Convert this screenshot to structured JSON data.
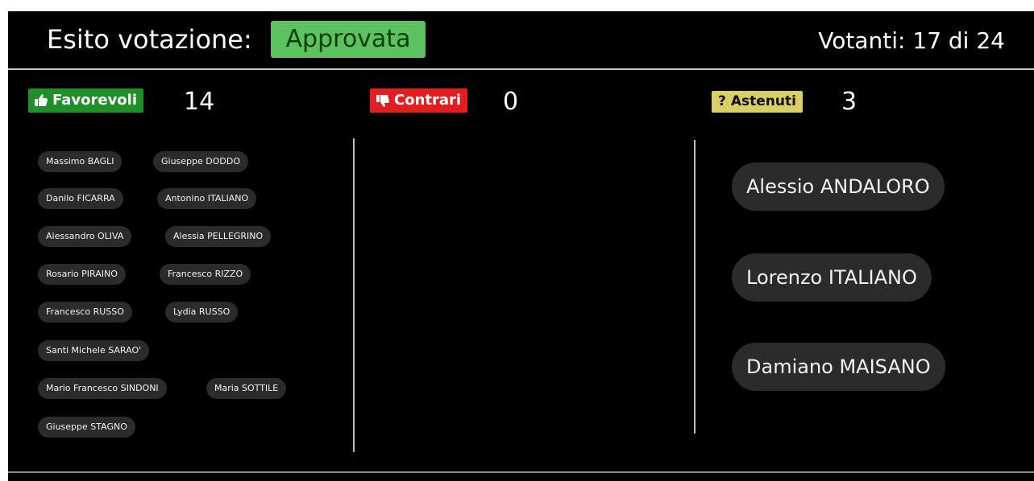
{
  "header": {
    "title": "Esito votazione:",
    "outcome": "Approvata",
    "voters": "Votanti: 17 di 24"
  },
  "columns": {
    "favorevoli": {
      "label": "Favorevoli",
      "count": "14",
      "icon": "thumbs-up-icon"
    },
    "contrari": {
      "label": "Contrari",
      "count": "0",
      "icon": "thumbs-down-icon"
    },
    "astenuti": {
      "label": "Astenuti",
      "count": "3",
      "icon": "question-icon",
      "icon_glyph": "?"
    }
  },
  "favorevoli_names": [
    "Massimo BAGLI",
    "Giuseppe DODDO",
    "Danilo FICARRA",
    "Antonino ITALIANO",
    "Alessandro OLIVA",
    "Alessia PELLEGRINO",
    "Rosario PIRAINO",
    "Francesco RIZZO",
    "Francesco RUSSO",
    "Lydia RUSSO",
    "Santi Michele SARAO'",
    "Mario Francesco SINDONI",
    "Maria SOTTILE",
    "Giuseppe STAGNO"
  ],
  "astenuti_names": [
    "Alessio ANDALORO",
    "Lorenzo ITALIANO",
    "Damiano MAISANO"
  ],
  "colors": {
    "background": "#000000",
    "approved": "#5cc25f",
    "favorevoli": "#1f8f2a",
    "contrari": "#e31e1e",
    "astenuti": "#d9cf64",
    "chip": "#2b2b2b"
  }
}
